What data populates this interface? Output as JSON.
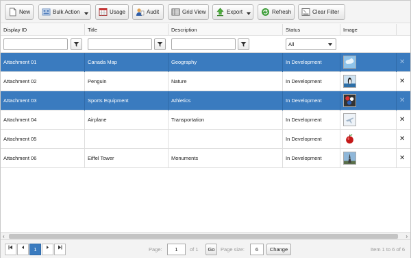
{
  "toolbar": {
    "new": "New",
    "bulk_action": "Bulk Action",
    "usage": "Usage",
    "audit": "Audit",
    "grid_view": "Grid View",
    "export": "Export",
    "refresh": "Refresh",
    "clear_filter": "Clear Filter"
  },
  "columns": {
    "display_id": "Display ID",
    "title": "Title",
    "description": "Description",
    "status": "Status",
    "image": "Image"
  },
  "filters": {
    "status_selected": "All"
  },
  "rows": [
    {
      "display_id": "Attachment 01",
      "title": "Canada Map",
      "description": "Geography",
      "status": "In Development",
      "image": "map-thumbnail",
      "selected": true
    },
    {
      "display_id": "Attachment 02",
      "title": "Penguin",
      "description": "Nature",
      "status": "In Development",
      "image": "penguin-thumbnail",
      "selected": false
    },
    {
      "display_id": "Attachment 03",
      "title": "Sports Equipment",
      "description": "Athletics",
      "status": "In Development",
      "image": "sports-thumbnail",
      "selected": true
    },
    {
      "display_id": "Attachment 04",
      "title": "Airplane",
      "description": "Transportation",
      "status": "In Development",
      "image": "airplane-thumbnail",
      "selected": false
    },
    {
      "display_id": "Attachment 05",
      "title": "",
      "description": "",
      "status": "In Development",
      "image": "apple-thumbnail",
      "selected": false
    },
    {
      "display_id": "Attachment 06",
      "title": "Eiffel Tower",
      "description": "Monuments",
      "status": "In Development",
      "image": "eiffel-thumbnail",
      "selected": false
    }
  ],
  "row_delete_glyph": "✕",
  "pager": {
    "current_page_button": "1",
    "page_label": "Page:",
    "page_value": "1",
    "of_label": "of 1",
    "go_label": "Go",
    "page_size_label": "Page size:",
    "page_size_value": "6",
    "change_label": "Change",
    "summary": "Item 1 to 6 of 6"
  },
  "colors": {
    "selected_row": "#3a7bbf",
    "toolbar_bg": "#f4f4f4"
  }
}
